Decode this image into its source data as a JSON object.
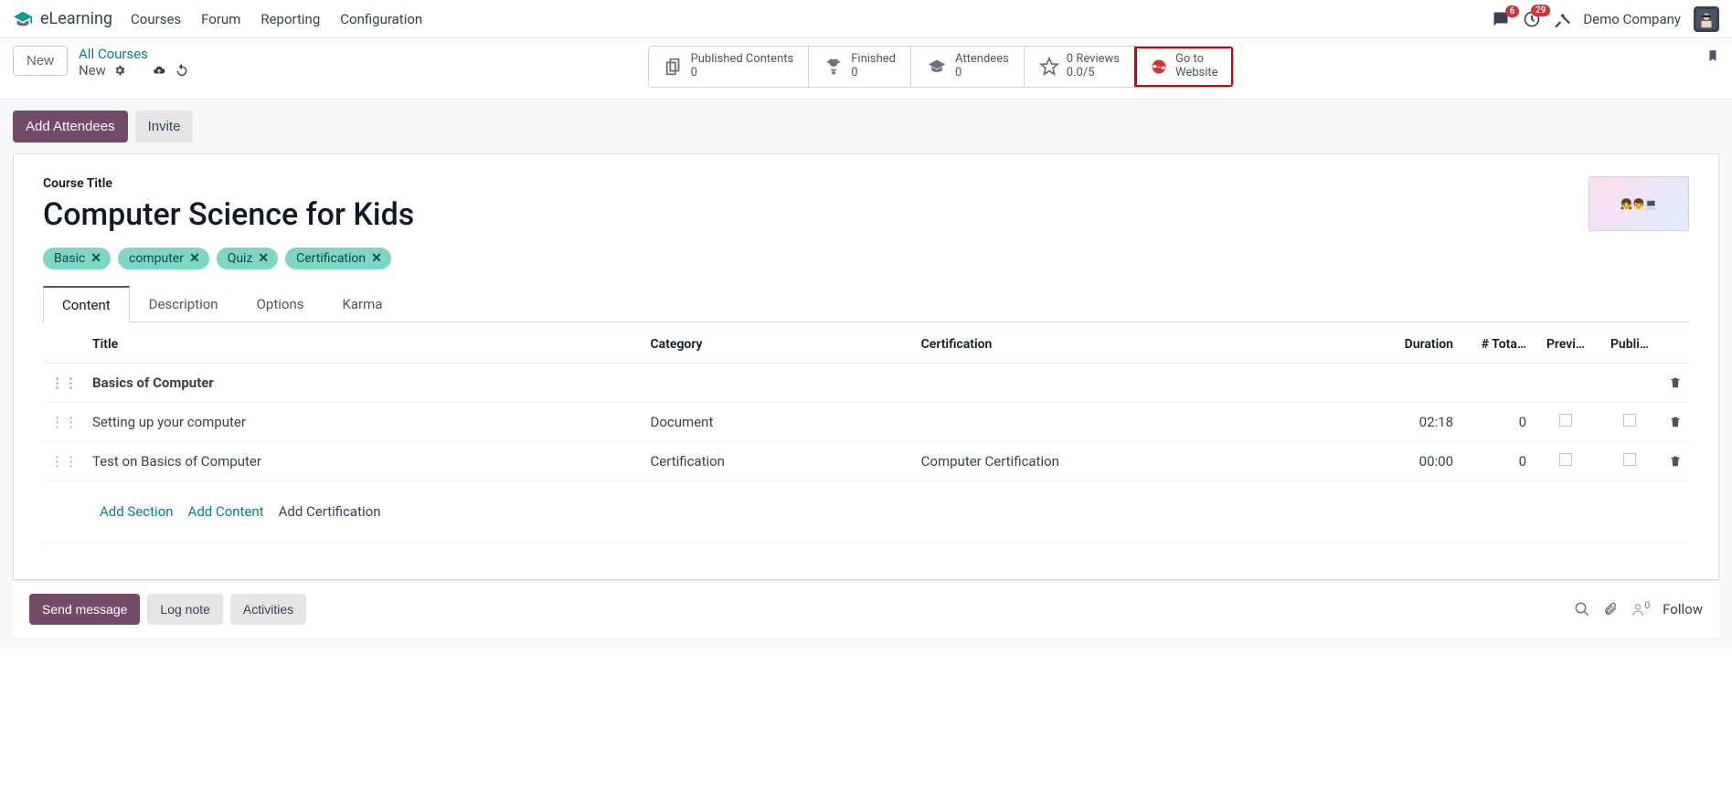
{
  "header": {
    "brand": "eLearning",
    "nav": [
      "Courses",
      "Forum",
      "Reporting",
      "Configuration"
    ],
    "msg_badge": "6",
    "activity_badge": "29",
    "company": "Demo Company"
  },
  "cp": {
    "new": "New",
    "breadcrumb_root": "All Courses",
    "breadcrumb_current": "New",
    "stats": {
      "published_label": "Published Contents",
      "published_val": "0",
      "finished_label": "Finished",
      "finished_val": "0",
      "attendees_label": "Attendees",
      "attendees_val": "0",
      "reviews_label": "0 Reviews",
      "reviews_val": "0.0/5",
      "goto_l1": "Go to",
      "goto_l2": "Website"
    }
  },
  "actions": {
    "add_attendees": "Add Attendees",
    "invite": "Invite"
  },
  "form": {
    "title_label": "Course Title",
    "title": "Computer Science for Kids",
    "tags": [
      "Basic",
      "computer",
      "Quiz",
      "Certification"
    ],
    "tabs": [
      "Content",
      "Description",
      "Options",
      "Karma"
    ],
    "columns": {
      "title": "Title",
      "category": "Category",
      "certification": "Certification",
      "duration": "Duration",
      "total": "# Tota…",
      "preview": "Previ…",
      "published": "Publi…"
    },
    "section": "Basics of Computer",
    "rows": [
      {
        "title": "Setting up your computer",
        "category": "Document",
        "certification": "",
        "duration": "02:18",
        "total": "0"
      },
      {
        "title": "Test on Basics of Computer",
        "category": "Certification",
        "certification": "Computer Certification",
        "duration": "00:00",
        "total": "0"
      }
    ],
    "add_section": "Add Section",
    "add_content": "Add Content",
    "add_cert": "Add Certification"
  },
  "chatter": {
    "send": "Send message",
    "log": "Log note",
    "activities": "Activities",
    "follower_count": "0",
    "follow": "Follow"
  }
}
